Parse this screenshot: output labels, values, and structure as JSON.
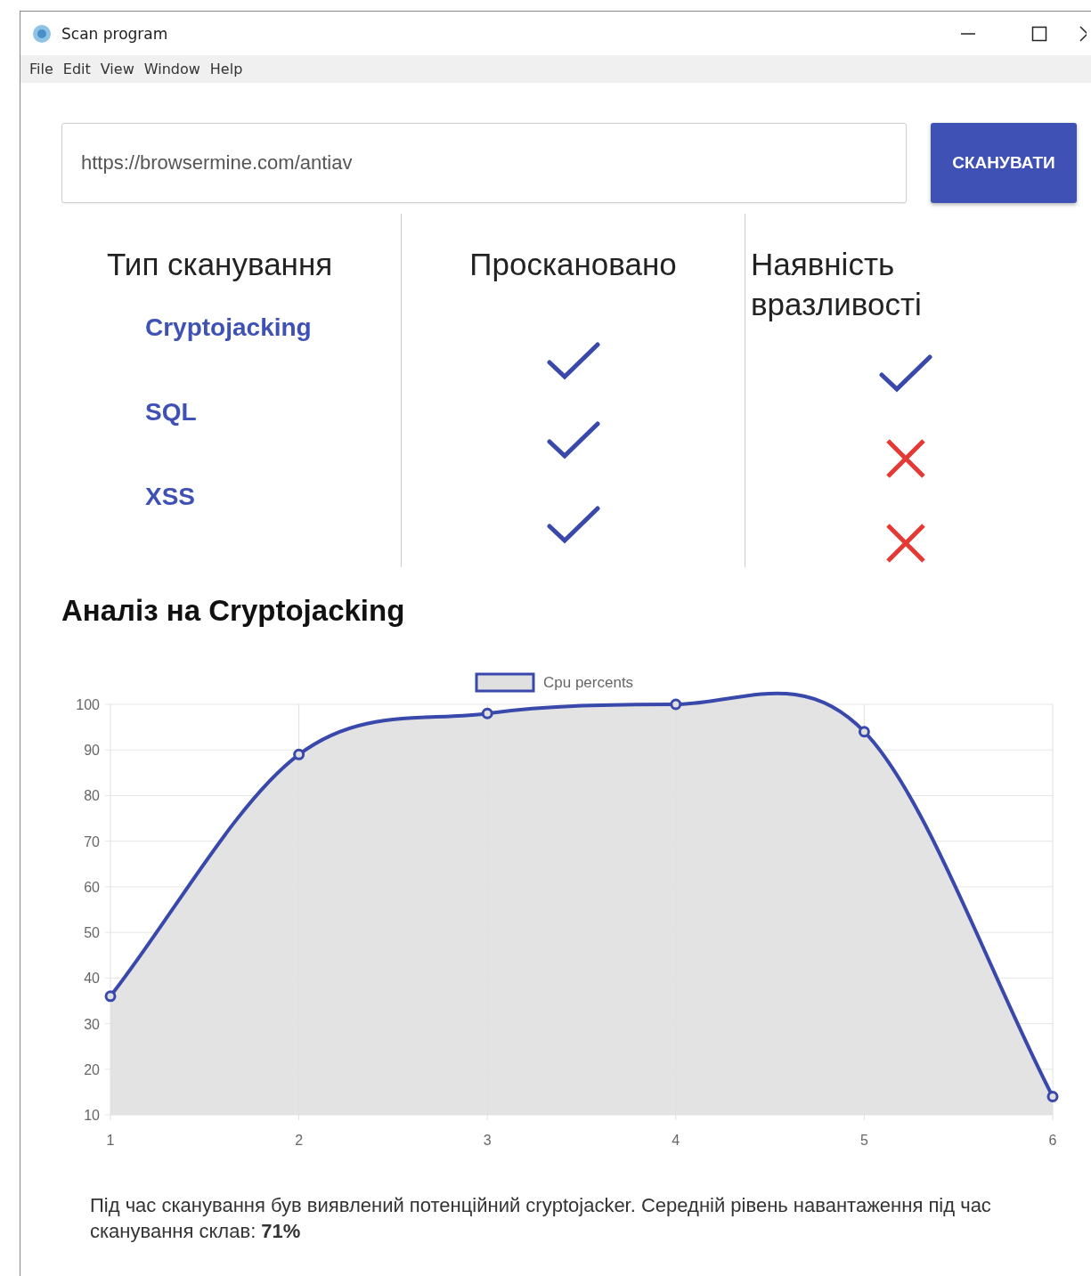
{
  "window": {
    "title": "Scan program"
  },
  "menu": [
    "File",
    "Edit",
    "View",
    "Window",
    "Help"
  ],
  "url_field": {
    "value": "https://browsermine.com/antiav"
  },
  "scan_button": "СКАНУВАТИ",
  "columns": [
    "Тип сканування",
    "Проскановано",
    "Наявність вразливості"
  ],
  "scan_types": [
    {
      "name": "Cryptojacking",
      "scanned": true,
      "vulnerable": true
    },
    {
      "name": "SQL",
      "scanned": true,
      "vulnerable": false
    },
    {
      "name": "XSS",
      "scanned": true,
      "vulnerable": false
    }
  ],
  "analysis": {
    "title": "Аналіз на Cryptojacking",
    "chart_data": {
      "type": "area",
      "x": [
        1,
        2,
        3,
        4,
        5,
        6
      ],
      "series": [
        {
          "name": "Cpu percents",
          "color": "#3949ab",
          "values": [
            36,
            89,
            98,
            100,
            94,
            14
          ]
        }
      ],
      "ylim": [
        10,
        100
      ],
      "yticks": [
        10,
        20,
        30,
        40,
        50,
        60,
        70,
        80,
        90,
        100
      ],
      "xticks": [
        1,
        2,
        3,
        4,
        5,
        6
      ],
      "xlim": [
        1,
        6
      ],
      "grid": true
    },
    "summary": "Під час сканування був виявлений потенційний cryptojacker. Середній рівень навантаження під час сканування склав: **71%**"
  }
}
